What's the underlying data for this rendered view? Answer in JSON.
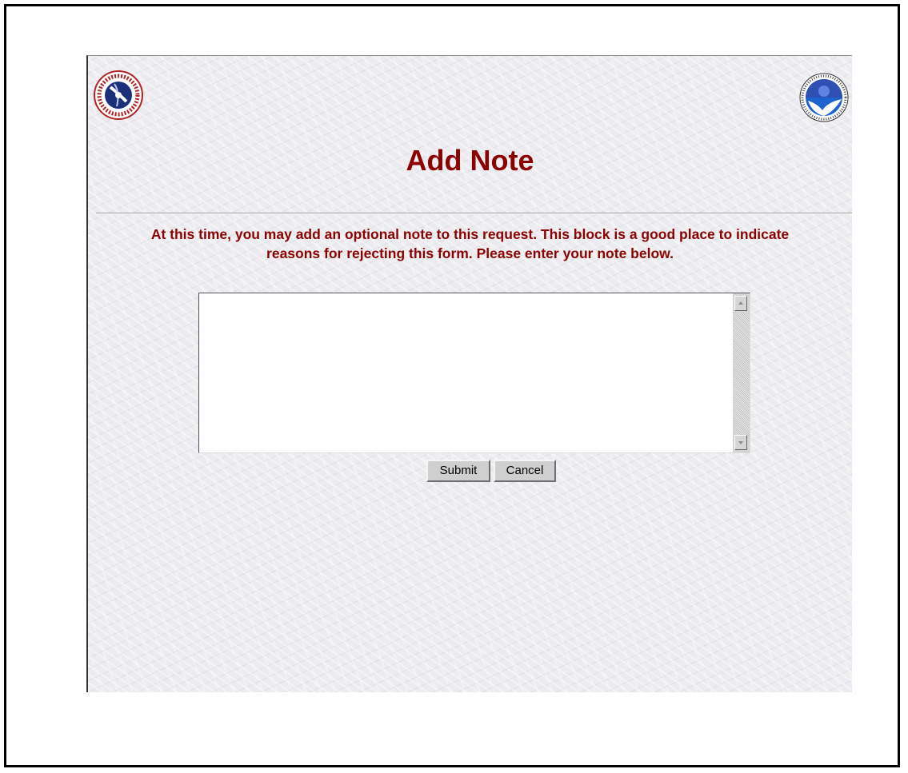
{
  "page": {
    "title": "Add Note",
    "instructions_line1": "At this time, you may add an optional note to this request. This block is a good place to indicate",
    "instructions_line2": "reasons for rejecting this form. Please enter your note below."
  },
  "note_input": {
    "value": "",
    "placeholder": ""
  },
  "buttons": {
    "submit_label": "Submit",
    "cancel_label": "Cancel"
  },
  "logos": {
    "left": "national-weather-service-logo",
    "right": "noaa-logo"
  },
  "colors": {
    "title": "#8b0000",
    "background": "#ecebef",
    "button": "#cfcfcf"
  }
}
